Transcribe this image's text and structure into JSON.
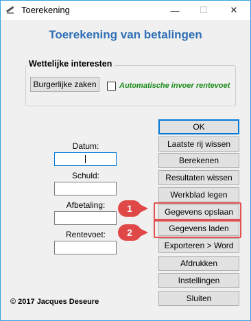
{
  "window": {
    "title": "Toerekening",
    "min_glyph": "—",
    "max_glyph": "☐",
    "close_glyph": "✕"
  },
  "main_title": "Toerekening van betalingen",
  "group": {
    "title": "Wettelijke interesten",
    "button_label": "Burgerlijke zaken",
    "checkbox_label": "Automatische invoer rentevoet",
    "checkbox_checked": false
  },
  "fields": {
    "datum": {
      "label": "Datum:",
      "value": ""
    },
    "schuld": {
      "label": "Schuld:",
      "value": ""
    },
    "afbetaling": {
      "label": "Afbetaling:",
      "value": ""
    },
    "rentevoet": {
      "label": "Rentevoet:",
      "value": ""
    }
  },
  "buttons": {
    "ok": "OK",
    "laatste_rij": "Laatste rij wissen",
    "berekenen": "Berekenen",
    "resultaten": "Resultaten wissen",
    "werkblad": "Werkblad legen",
    "opslaan": "Gegevens opslaan",
    "laden": "Gegevens laden",
    "exporteren": "Exporteren > Word",
    "afdrukken": "Afdrukken",
    "instellingen": "Instellingen",
    "sluiten": "Sluiten"
  },
  "callouts": {
    "first": "1",
    "second": "2",
    "color": "#e04848"
  },
  "copyright": "© 2017 Jacques Deseure",
  "colors": {
    "title_blue": "#2f6fb5",
    "checkbox_label_green": "#1a8a1a",
    "focus_blue": "#0078d7"
  }
}
